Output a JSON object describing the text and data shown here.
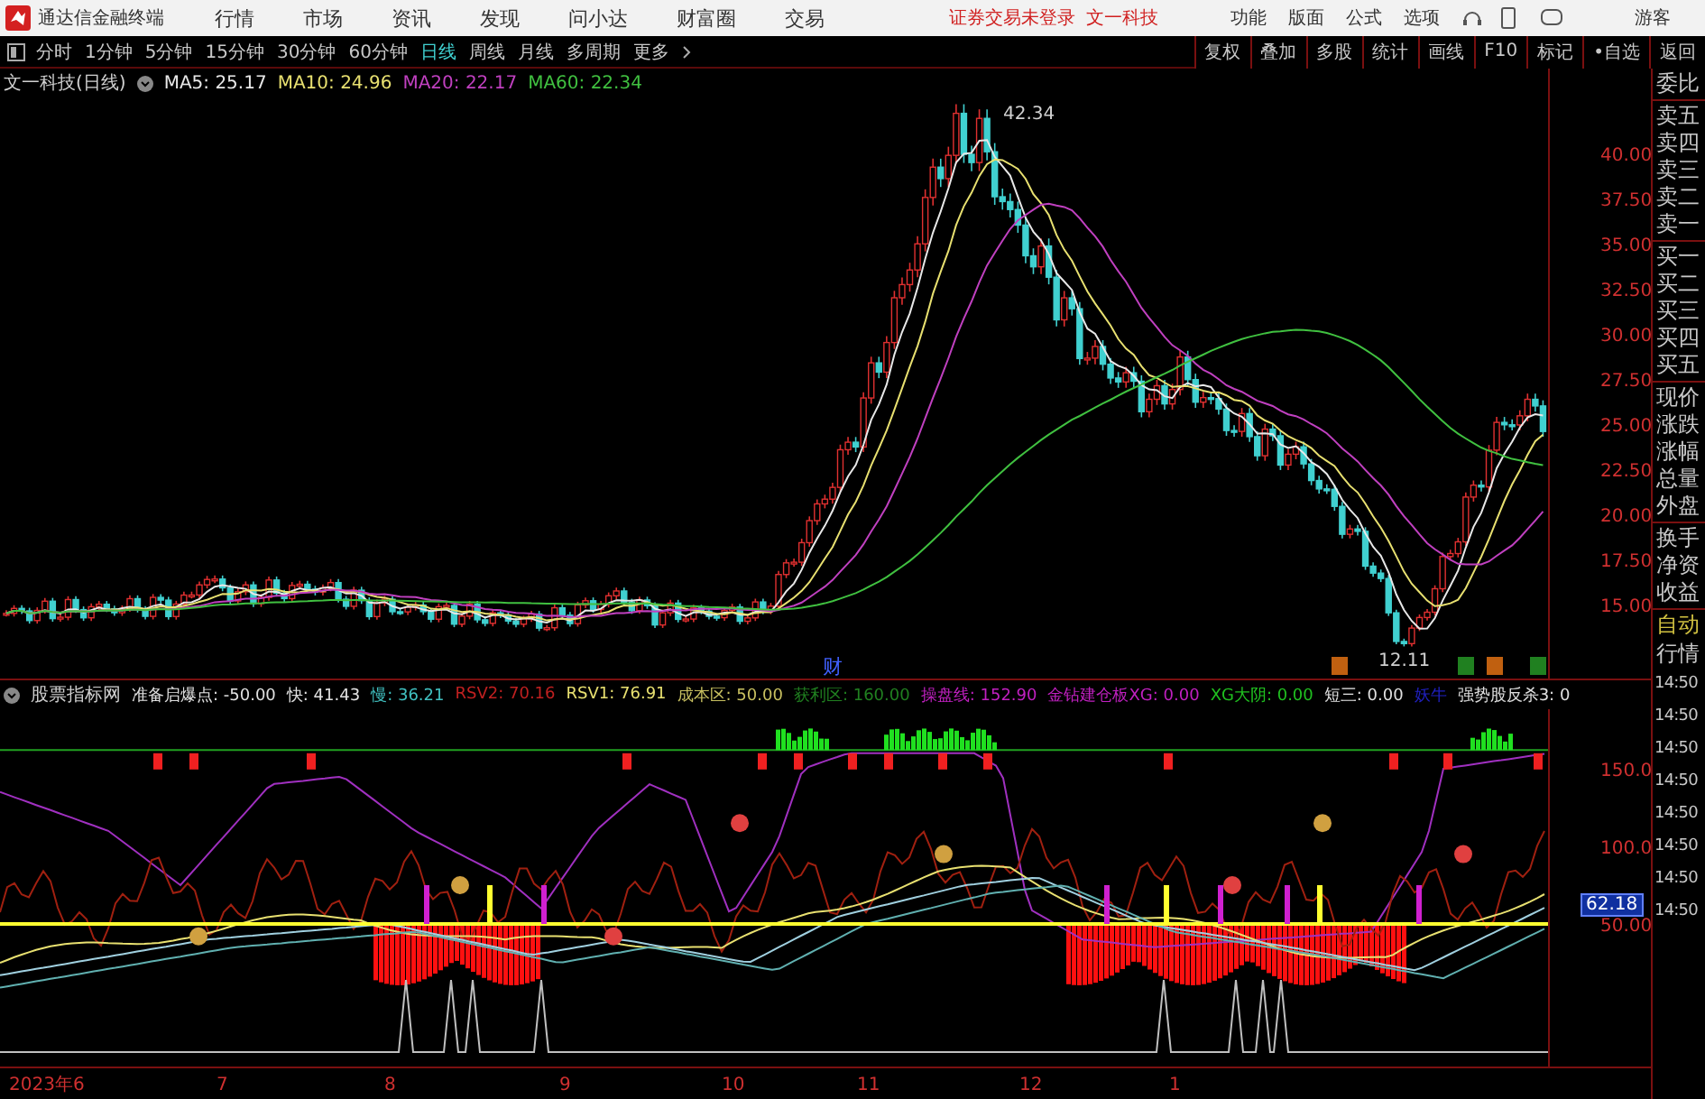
{
  "menu_bar": {
    "app_name": "通达信金融终端",
    "menus": [
      "行情",
      "市场",
      "资讯",
      "发现",
      "问小达",
      "财富圈",
      "交易"
    ],
    "login_notice": "证券交易未登录",
    "stock_name": "文一科技",
    "tools": [
      "功能",
      "版面",
      "公式",
      "选项"
    ],
    "user": "游客"
  },
  "toolbar": {
    "periods": [
      {
        "label": "分时",
        "selected": false
      },
      {
        "label": "1分钟",
        "selected": false
      },
      {
        "label": "5分钟",
        "selected": false
      },
      {
        "label": "15分钟",
        "selected": false
      },
      {
        "label": "30分钟",
        "selected": false
      },
      {
        "label": "60分钟",
        "selected": false
      },
      {
        "label": "日线",
        "selected": true
      },
      {
        "label": "周线",
        "selected": false
      },
      {
        "label": "月线",
        "selected": false
      },
      {
        "label": "多周期",
        "selected": false
      }
    ],
    "more": "更多",
    "actions": [
      "复权",
      "叠加",
      "多股",
      "统计",
      "画线",
      "F10",
      "标记",
      "•自选",
      "返回"
    ]
  },
  "main_chart": {
    "title": "文一科技(日线)",
    "averages": [
      {
        "label": "MA5: 25.17",
        "color": "#e8e8e8"
      },
      {
        "label": "MA10: 24.96",
        "color": "#e8e070"
      },
      {
        "label": "MA20: 22.17",
        "color": "#c040c0"
      },
      {
        "label": "MA60: 22.34",
        "color": "#40c040"
      }
    ],
    "price_ticks": [
      "40.00",
      "37.50",
      "35.00",
      "32.50",
      "30.00",
      "27.50",
      "25.00",
      "22.50",
      "20.00",
      "17.50",
      "15.00"
    ],
    "high_label": "42.34",
    "low_label": "12.11",
    "event_marker": "财"
  },
  "indicator": {
    "name": "股票指标网",
    "readouts": [
      {
        "label": "准备启爆点: -50.00",
        "color": "#e0e0e0"
      },
      {
        "label": "快: 41.43",
        "color": "#e0e0e0"
      },
      {
        "label": "慢: 36.21",
        "color": "#40c0c0"
      },
      {
        "label": "RSV2: 70.16",
        "color": "#c02020"
      },
      {
        "label": "RSV1: 76.91",
        "color": "#e8e070"
      },
      {
        "label": "成本区: 50.00",
        "color": "#c8c060"
      },
      {
        "label": "获利区: 160.00",
        "color": "#208020"
      },
      {
        "label": "操盘线: 152.90",
        "color": "#c020c0"
      },
      {
        "label": "金钻建仓板XG: 0.00",
        "color": "#c020c0"
      },
      {
        "label": "XG大阴: 0.00",
        "color": "#20c020"
      },
      {
        "label": "短三: 0.00",
        "color": "#e0e0e0"
      },
      {
        "label": "妖牛",
        "color": "#2020c0"
      },
      {
        "label": "强势股反杀3: 0",
        "color": "#e0e0e0"
      }
    ],
    "ticks": [
      "150.0",
      "100.0",
      "50.00"
    ],
    "current_value": "62.18"
  },
  "date_axis": [
    "2023年6",
    "7",
    "8",
    "9",
    "10",
    "11",
    "12",
    "1"
  ],
  "side_panel": {
    "groups": [
      [
        "委比"
      ],
      [
        "卖五",
        "卖四",
        "卖三",
        "卖二",
        "卖一"
      ],
      [
        "买一",
        "买二",
        "买三",
        "买四",
        "买五"
      ],
      [
        "现价",
        "涨跌",
        "涨幅",
        "总量",
        "外盘"
      ],
      [
        "换手",
        "净资",
        "收益"
      ]
    ],
    "mode": [
      "自动",
      "行情"
    ],
    "times": [
      "14:50",
      "14:50",
      "14:50",
      "14:50",
      "14:50",
      "14:50",
      "14:50",
      "14:50"
    ]
  }
}
